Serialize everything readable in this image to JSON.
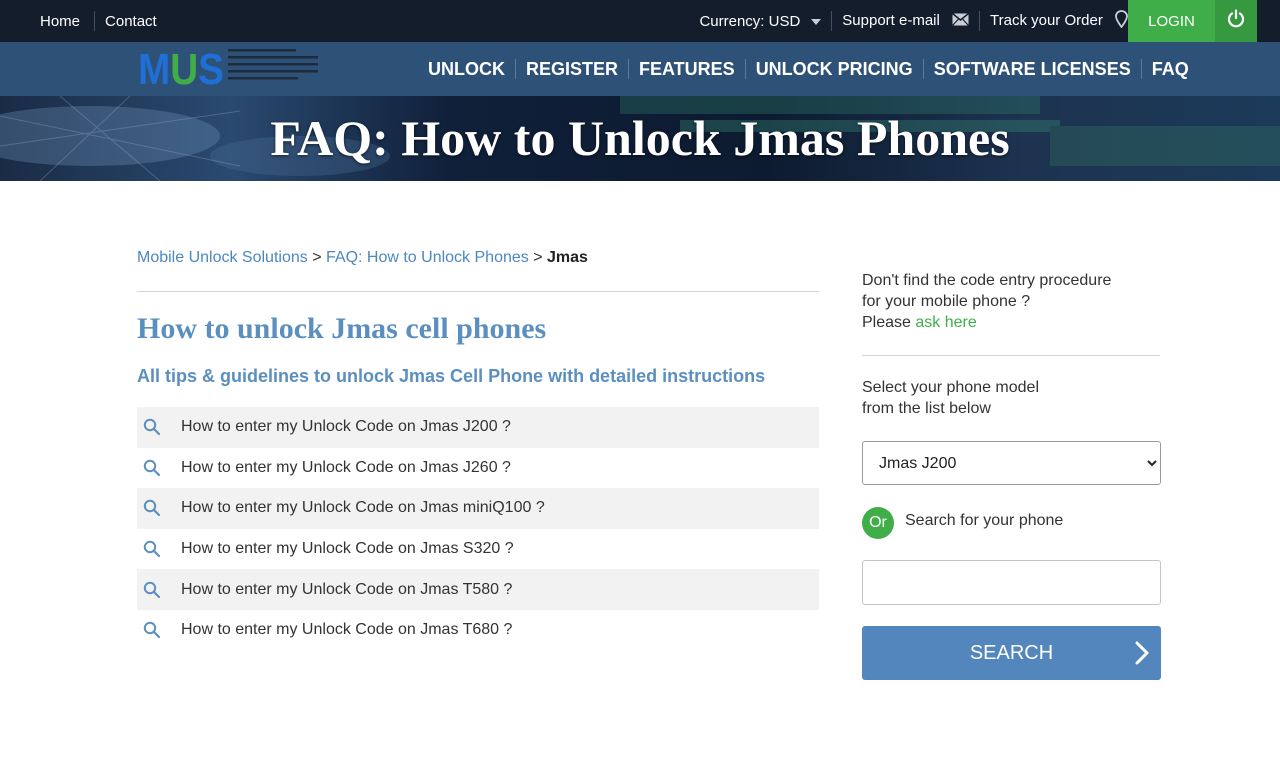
{
  "topbar": {
    "home": "Home",
    "contact": "Contact",
    "currency": "Currency: USD",
    "support": "Support e-mail",
    "track": "Track your Order",
    "login": "LOGIN"
  },
  "logo": {
    "text": "MUS"
  },
  "nav": {
    "items": [
      "UNLOCK",
      "REGISTER",
      "FEATURES",
      "UNLOCK PRICING",
      "SOFTWARE LICENSES",
      "FAQ"
    ]
  },
  "banner": {
    "title": "FAQ: How to Unlock Jmas Phones"
  },
  "breadcrumb": {
    "root": "Mobile Unlock Solutions",
    "sep": ">",
    "parent": "FAQ: How to Unlock Phones",
    "current": "Jmas"
  },
  "main": {
    "title": "How to unlock Jmas cell phones",
    "subtitle": "All tips & guidelines to unlock Jmas Cell Phone with detailed instructions",
    "faqs": [
      "How to enter my Unlock Code on Jmas J200 ?",
      "How to enter my Unlock Code on Jmas J260 ?",
      "How to enter my Unlock Code on Jmas miniQ100 ?",
      "How to enter my Unlock Code on Jmas S320 ?",
      "How to enter my Unlock Code on Jmas T580 ?",
      "How to enter my Unlock Code on Jmas T680 ?"
    ]
  },
  "sidebar": {
    "note_line1": "Don't find the code entry procedure",
    "note_line2": "for your mobile phone ?",
    "note_please": "Please",
    "note_link": "ask here",
    "select_line1": "Select your phone model",
    "select_line2": "from the list below",
    "selected_model": "Jmas J200",
    "or_badge": "Or",
    "or_text": "Search for your phone",
    "search_value": "",
    "search_button": "SEARCH"
  },
  "colors": {
    "topbar_bg": "#141d2c",
    "navbar_bg": "#2e5177",
    "accent_green": "#3fae49",
    "heading_blue": "#5b8fbf",
    "link_blue": "#4c88c1",
    "button_blue": "#5286bd"
  },
  "icons": {
    "support": "envelope-icon",
    "track": "map-pin-icon",
    "power": "power-icon",
    "faq": "search-icon",
    "search_button": "chevron-right-icon",
    "currency": "caret-down-icon"
  }
}
